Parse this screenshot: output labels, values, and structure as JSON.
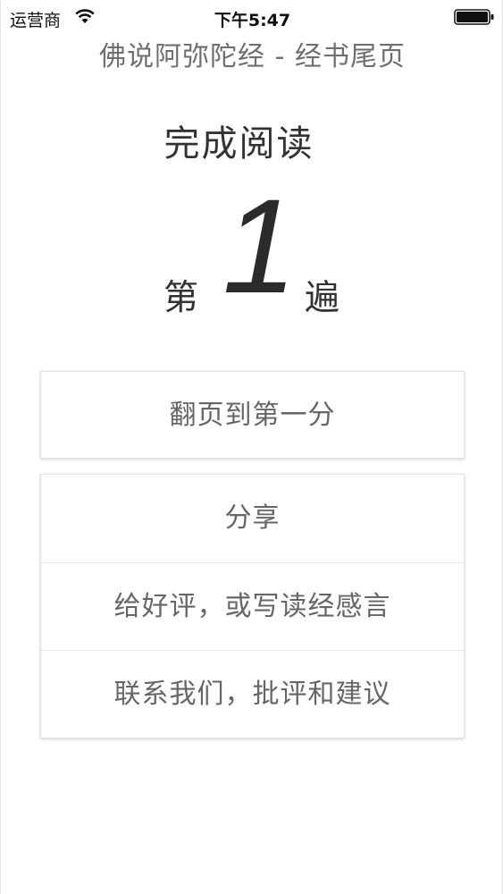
{
  "status_bar": {
    "carrier": "运营商",
    "time": "下午5:47",
    "wifi_icon": "wifi-icon",
    "battery_icon": "battery-icon"
  },
  "header": {
    "title": "佛说阿弥陀经 - 经书尾页"
  },
  "completion": {
    "label": "完成阅读",
    "prefix": "第",
    "count": "1",
    "suffix": "遍"
  },
  "actions": {
    "first_page": "翻页到第一分",
    "share": "分享",
    "review": "给好评，或写读经感言",
    "contact": "联系我们，批评和建议"
  },
  "colors": {
    "background": "#ffffff",
    "title_text": "#6f6f6f",
    "body_text": "#333333",
    "button_text": "#666666"
  }
}
